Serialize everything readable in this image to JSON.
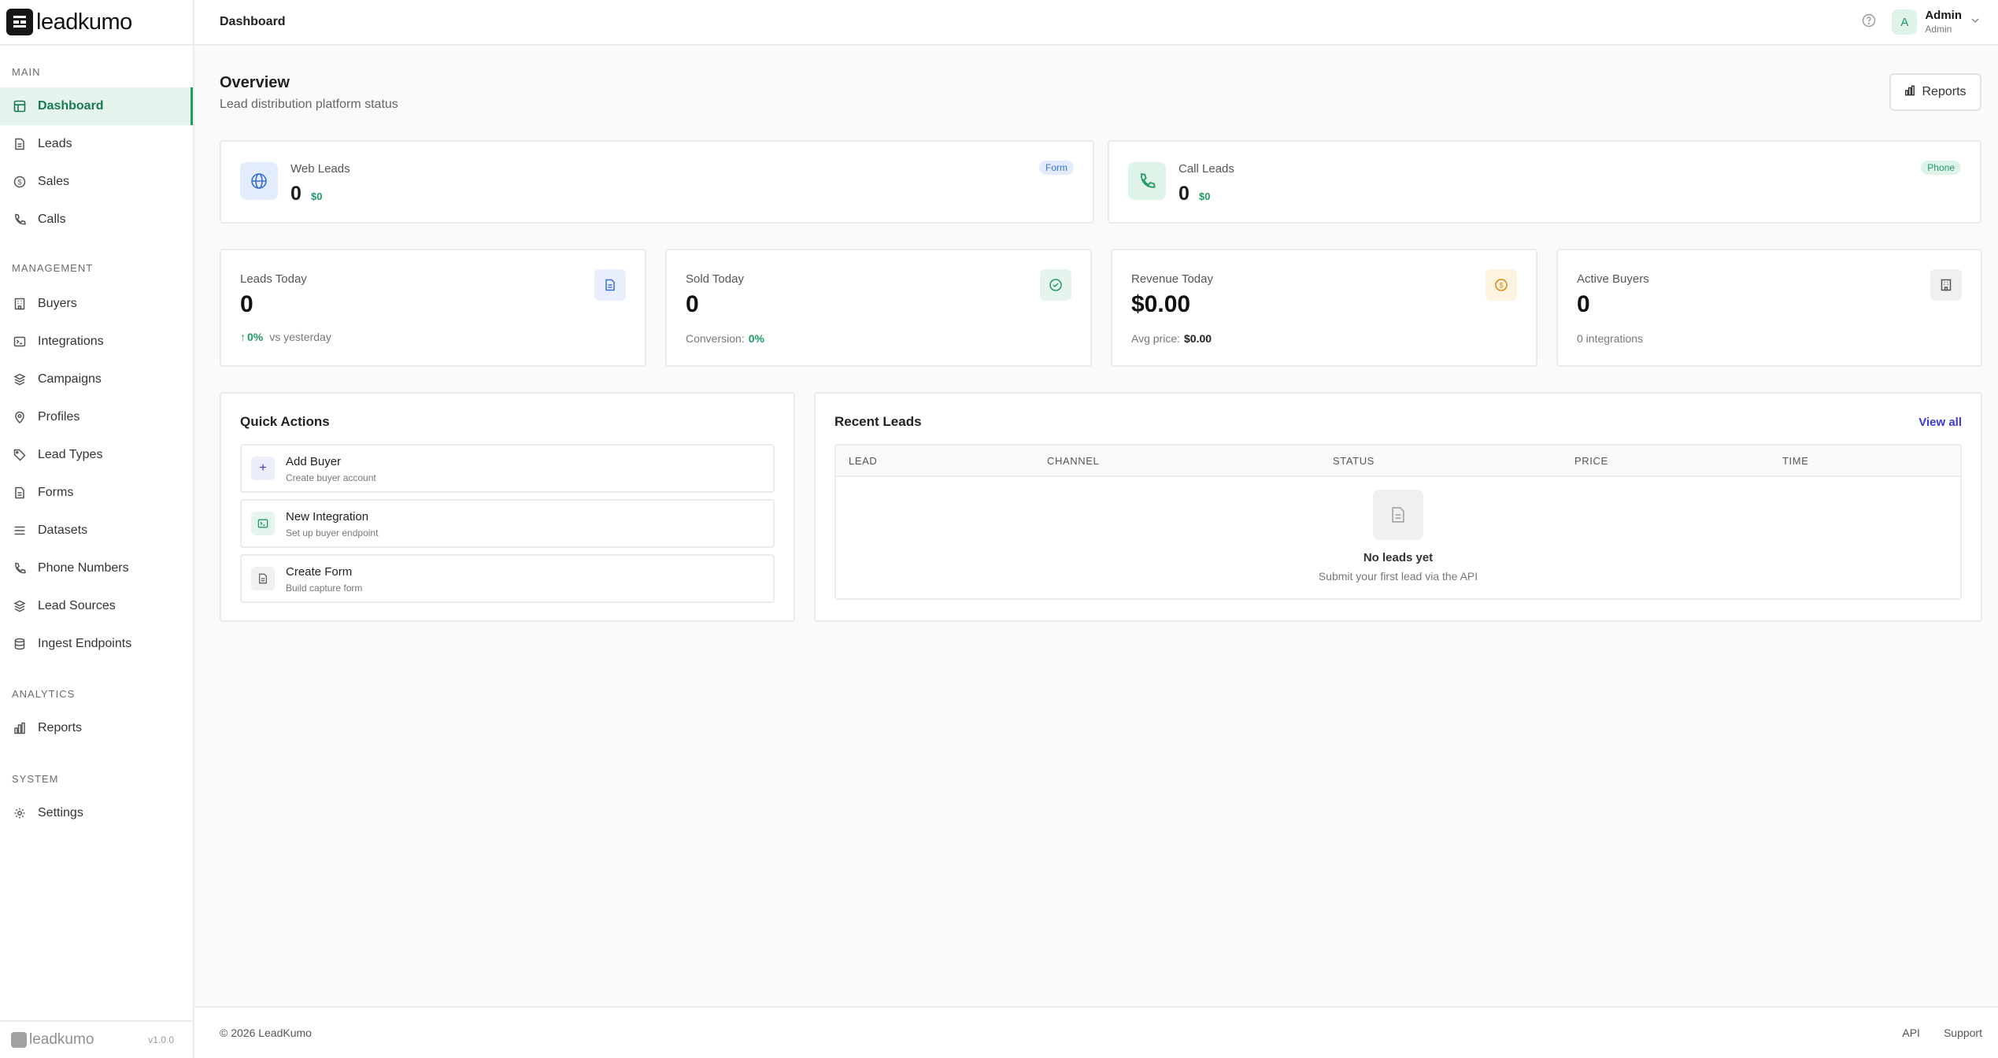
{
  "brand": {
    "name": "leadkumo",
    "version": "v1.0.0"
  },
  "sidebar": {
    "sections": [
      {
        "title": "MAIN",
        "items": [
          {
            "label": "Dashboard",
            "icon": "dashboard-icon",
            "active": true
          },
          {
            "label": "Leads",
            "icon": "file-icon"
          },
          {
            "label": "Sales",
            "icon": "dollar-icon"
          },
          {
            "label": "Calls",
            "icon": "phone-icon"
          }
        ]
      },
      {
        "title": "MANAGEMENT",
        "items": [
          {
            "label": "Buyers",
            "icon": "building-icon"
          },
          {
            "label": "Integrations",
            "icon": "terminal-icon"
          },
          {
            "label": "Campaigns",
            "icon": "layers-icon"
          },
          {
            "label": "Profiles",
            "icon": "location-pin-icon"
          },
          {
            "label": "Lead Types",
            "icon": "tag-icon"
          },
          {
            "label": "Forms",
            "icon": "file-icon"
          },
          {
            "label": "Datasets",
            "icon": "list-icon"
          },
          {
            "label": "Phone Numbers",
            "icon": "phone-icon"
          },
          {
            "label": "Lead Sources",
            "icon": "layers-icon"
          },
          {
            "label": "Ingest Endpoints",
            "icon": "database-icon"
          }
        ]
      },
      {
        "title": "ANALYTICS",
        "items": [
          {
            "label": "Reports",
            "icon": "bar-chart-icon"
          }
        ]
      },
      {
        "title": "SYSTEM",
        "items": [
          {
            "label": "Settings",
            "icon": "gear-icon"
          }
        ]
      }
    ]
  },
  "topbar": {
    "title": "Dashboard",
    "user": {
      "initial": "A",
      "name": "Admin",
      "role": "Admin"
    }
  },
  "overview": {
    "title": "Overview",
    "subtitle": "Lead distribution platform status",
    "reports_label": "Reports"
  },
  "channels": [
    {
      "label": "Web Leads",
      "count": "0",
      "money": "$0",
      "badge": "Form",
      "accent": "#3b6fd4",
      "icon": "globe-icon"
    },
    {
      "label": "Call Leads",
      "count": "0",
      "money": "$0",
      "badge": "Phone",
      "accent": "#1f9b63",
      "icon": "phone-icon"
    }
  ],
  "stats": [
    {
      "label": "Leads Today",
      "value": "0",
      "foot_prefix": "",
      "foot_value": "0%",
      "foot_suffix": "vs yesterday",
      "icon": "document-icon"
    },
    {
      "label": "Sold Today",
      "value": "0",
      "foot_prefix": "Conversion:",
      "foot_value": "0%",
      "foot_suffix": "",
      "icon": "check-circle-icon"
    },
    {
      "label": "Revenue Today",
      "value": "$0.00",
      "foot_prefix": "Avg price:",
      "foot_value": "$0.00",
      "foot_suffix": "",
      "icon": "dollar-circle-icon"
    },
    {
      "label": "Active Buyers",
      "value": "0",
      "foot_prefix": "0 integrations",
      "foot_value": "",
      "foot_suffix": "",
      "icon": "building-icon"
    }
  ],
  "quick_actions": {
    "title": "Quick Actions",
    "items": [
      {
        "title": "Add Buyer",
        "subtitle": "Create buyer account",
        "icon": "plus-icon"
      },
      {
        "title": "New Integration",
        "subtitle": "Set up buyer endpoint",
        "icon": "terminal-icon"
      },
      {
        "title": "Create Form",
        "subtitle": "Build capture form",
        "icon": "document-icon"
      }
    ]
  },
  "recent_leads": {
    "title": "Recent Leads",
    "view_all": "View all",
    "columns": [
      "LEAD",
      "CHANNEL",
      "STATUS",
      "PRICE",
      "TIME"
    ],
    "empty_title": "No leads yet",
    "empty_subtitle": "Submit your first lead via the API"
  },
  "footer": {
    "copyright": "© 2026 LeadKumo",
    "links": [
      "API",
      "Support"
    ]
  }
}
